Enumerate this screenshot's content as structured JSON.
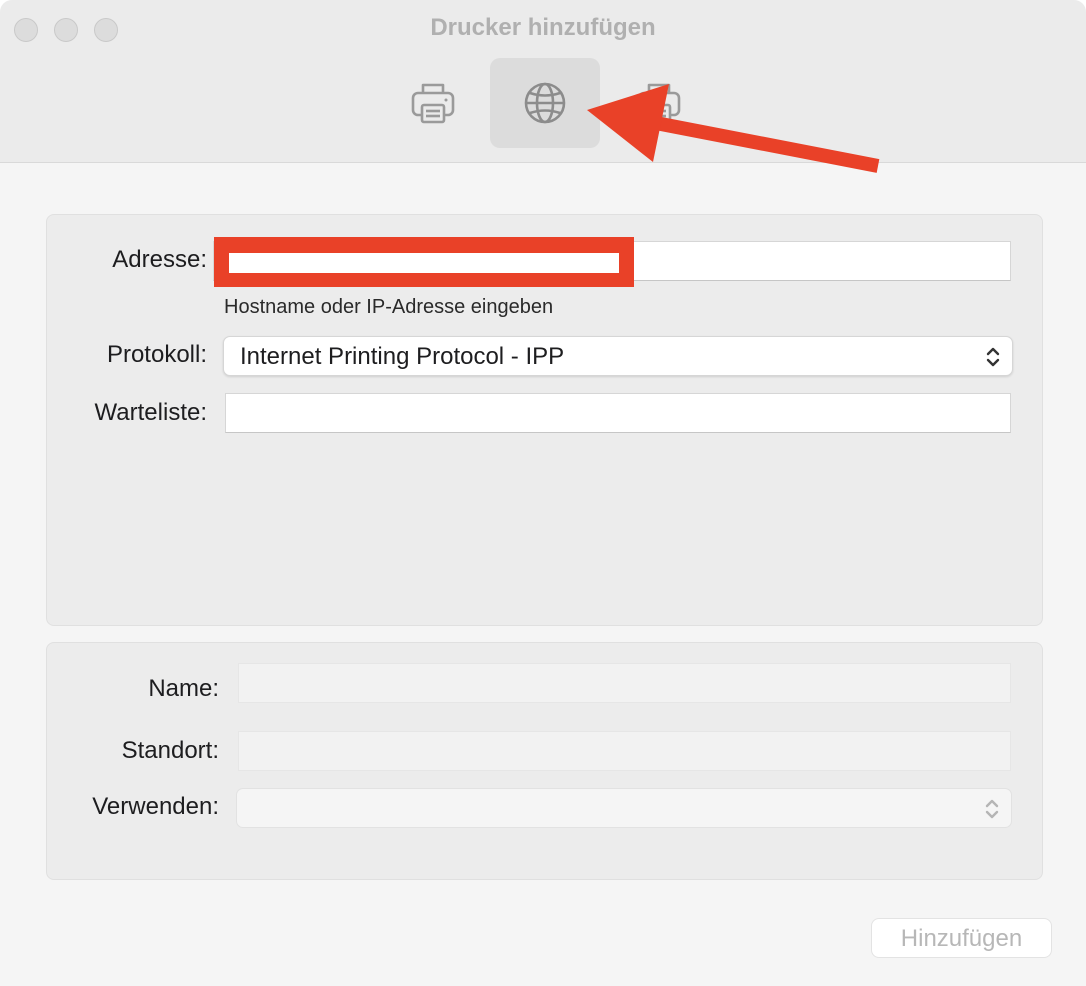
{
  "window": {
    "title": "Drucker hinzufügen"
  },
  "toolbar": {
    "items": [
      {
        "icon": "printer-icon",
        "selected": false
      },
      {
        "icon": "globe-icon",
        "selected": true
      },
      {
        "icon": "printer-windows-icon",
        "selected": false
      }
    ]
  },
  "form": {
    "address_label": "Adresse:",
    "address_value": "",
    "address_hint": "Hostname oder IP-Adresse eingeben",
    "protocol_label": "Protokoll:",
    "protocol_value": "Internet Printing Protocol - IPP",
    "queue_label": "Warteliste:",
    "queue_value": ""
  },
  "details": {
    "name_label": "Name:",
    "name_value": "",
    "location_label": "Standort:",
    "location_value": "",
    "use_label": "Verwenden:",
    "use_value": ""
  },
  "footer": {
    "add_button_label": "Hinzufügen"
  },
  "colors": {
    "annotation_red": "#e94128",
    "window_bg": "#f5f5f5",
    "toolbar_bg": "#ebebeb"
  }
}
